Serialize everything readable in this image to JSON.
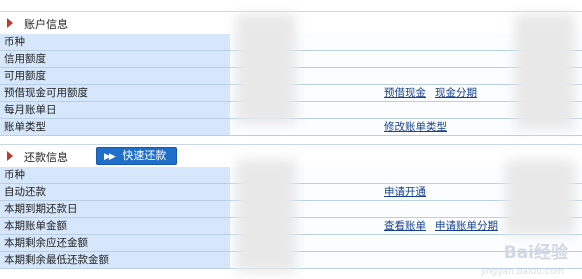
{
  "account_section": {
    "title": "账户信息",
    "rows": [
      "币种",
      "信用额度",
      "可用额度",
      "预借现金可用额度",
      "每月账单日",
      "账单类型"
    ],
    "links": {
      "cash_advance": "预借现金",
      "cash_installment": "现金分期",
      "change_bill_type": "修改账单类型"
    }
  },
  "repay_section": {
    "title": "还款信息",
    "quick_repay_button": "快速还款",
    "rows": [
      "币种",
      "自动还款",
      "本期到期还款日",
      "本期账单金额",
      "本期剩余应还金额",
      "本期剩余最低还款金额"
    ],
    "links": {
      "apply_open": "申请开通",
      "view_bill": "查看账单",
      "apply_installment": "申请账单分期"
    }
  },
  "watermark": {
    "text": "Bai经验",
    "sub": "jingyan.baidu.com"
  },
  "colors": {
    "label_bg": "#d6e7fb",
    "link": "#17418a",
    "button": "#1f6ec9"
  }
}
